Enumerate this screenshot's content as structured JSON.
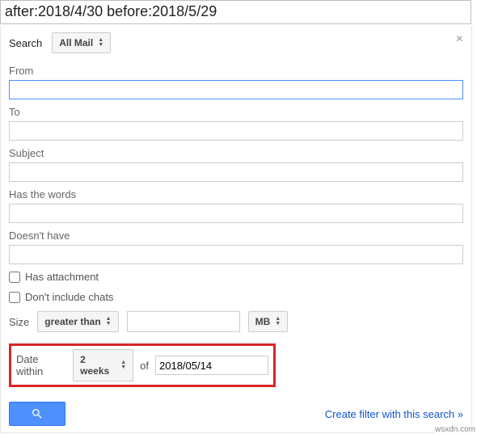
{
  "topbar": {
    "query": "after:2018/4/30 before:2018/5/29"
  },
  "panel": {
    "close": "×",
    "search_label": "Search",
    "search_scope": "All Mail",
    "from_label": "From",
    "from_value": "",
    "to_label": "To",
    "to_value": "",
    "subject_label": "Subject",
    "subject_value": "",
    "haswords_label": "Has the words",
    "haswords_value": "",
    "doesnthave_label": "Doesn't have",
    "doesnthave_value": "",
    "attachment_label": "Has attachment",
    "chats_label": "Don't include chats",
    "size_label": "Size",
    "size_op": "greater than",
    "size_value": "",
    "size_unit": "MB",
    "date_label": "Date within",
    "date_range": "2 weeks",
    "date_of": "of",
    "date_value": "2018/05/14",
    "create_filter": "Create filter with this search »"
  },
  "watermark": "wsxdn.com"
}
